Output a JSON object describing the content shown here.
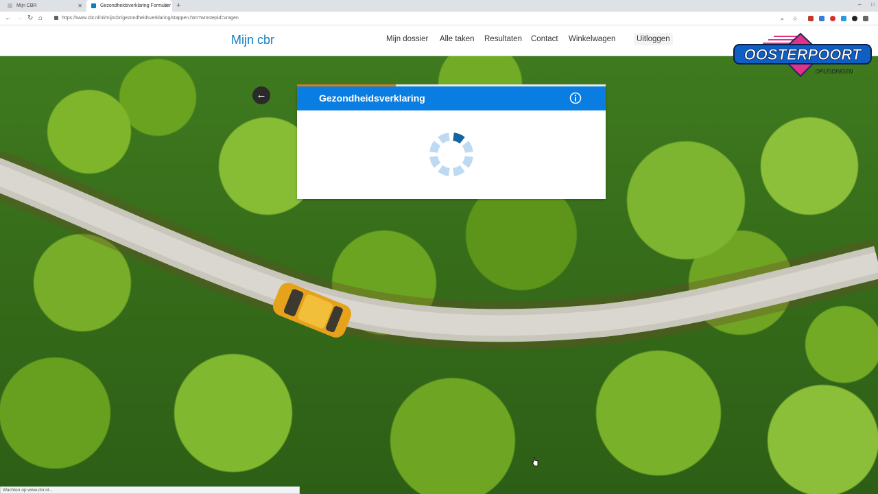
{
  "browser": {
    "tabs": [
      {
        "title": "Mijn CBR",
        "active": false
      },
      {
        "title": "Gezondheidsverklaring Formulier",
        "active": true
      }
    ],
    "new_tab_symbol": "+",
    "url": "https://www.cbr.nl/nl/mijncbr/gezondheidsverklaring/stappen.htm?wmstepid=vragen",
    "status_text": "Wachten op www.cbr.nl..."
  },
  "site": {
    "brand": "Mijn cbr",
    "nav": [
      "Mijn dossier",
      "Alle taken",
      "Resultaten",
      "Contact",
      "Winkelwagen"
    ],
    "logout": "Uitloggen"
  },
  "watermark": {
    "name": "OOSTERPOORT",
    "sub": "OPLEIDINGEN"
  },
  "modal": {
    "title": "Gezondheidsverklaring",
    "progress": 0.32,
    "state": "loading"
  },
  "colors": {
    "brand_blue": "#0d7dc2",
    "modal_header": "#0a7de3",
    "progress_orange": "#e07b1a",
    "spinner_active": "#12659f",
    "spinner_inactive": "#bedaf3"
  },
  "icons": {
    "back": "arrow-left-icon",
    "info": "info-icon",
    "spinner": "loading-spinner-icon"
  }
}
